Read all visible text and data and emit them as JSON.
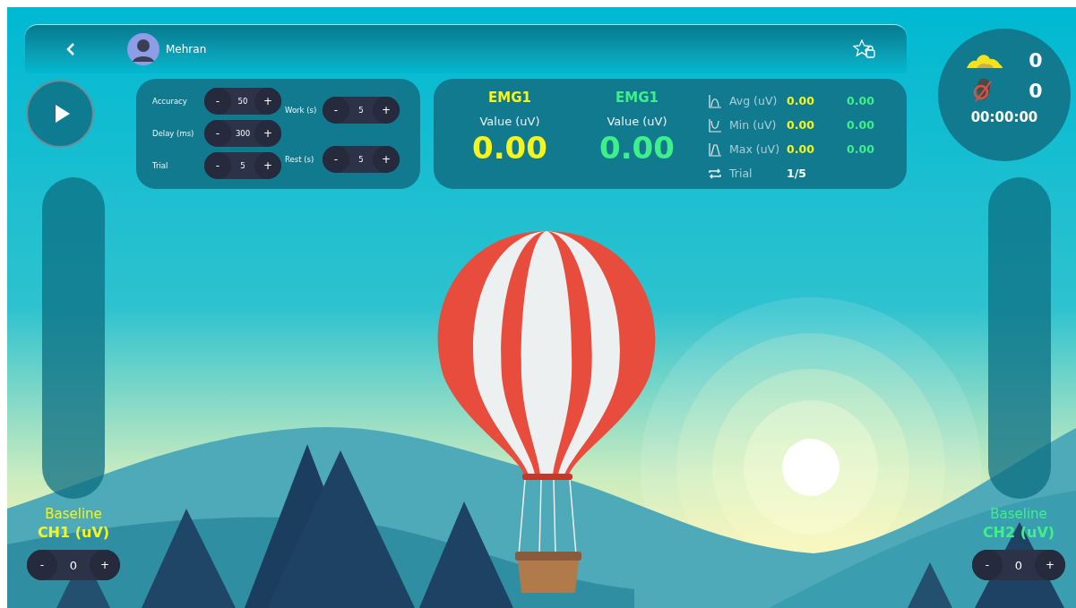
{
  "header": {
    "user": "Mehran"
  },
  "settings": {
    "left": [
      {
        "label": "Accuracy",
        "value": "50",
        "dec": "-",
        "inc": "+"
      },
      {
        "label": "Delay (ms)",
        "value": "300",
        "dec": "-",
        "inc": "+"
      },
      {
        "label": "Trial",
        "value": "5",
        "dec": "-",
        "inc": "+"
      }
    ],
    "right": [
      {
        "label": "Work (s)",
        "value": "5",
        "dec": "-",
        "inc": "+"
      },
      {
        "label": "Rest (s)",
        "value": "5",
        "dec": "-",
        "inc": "+"
      }
    ]
  },
  "channels": [
    {
      "name": "EMG1",
      "value_label": "Value (uV)",
      "value": "0.00",
      "color": "#f5f51e"
    },
    {
      "name": "EMG1",
      "value_label": "Value (uV)",
      "value": "0.00",
      "color": "#3ef08a"
    }
  ],
  "stats": [
    {
      "kind": "avg",
      "label": "Avg (uV)",
      "values": [
        "0.00",
        "0.00"
      ]
    },
    {
      "kind": "min",
      "label": "Min (uV)",
      "values": [
        "0.00",
        "0.00"
      ]
    },
    {
      "kind": "max",
      "label": "Max (uV)",
      "values": [
        "0.00",
        "0.00"
      ]
    },
    {
      "kind": "trial",
      "label": "Trial",
      "values": [
        "1/5"
      ]
    }
  ],
  "score": {
    "hits": "0",
    "misses": "0",
    "timer": "00:00:00"
  },
  "baselines": [
    {
      "title": "Baseline",
      "channel": "CH1 (uV)",
      "value": "0",
      "dec": "-",
      "inc": "+",
      "color": "#f5f51e"
    },
    {
      "title": "Baseline",
      "channel": "CH2 (uV)",
      "value": "0",
      "dec": "-",
      "inc": "+",
      "color": "#3ef08a"
    }
  ]
}
